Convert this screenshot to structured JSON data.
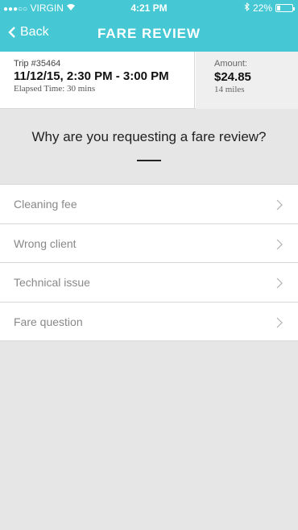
{
  "status_bar": {
    "signal_dots": "●●●○○",
    "carrier": "VIRGIN",
    "wifi_icon": "wifi-icon",
    "time": "4:21 PM",
    "bluetooth_icon": "bluetooth-icon",
    "battery_text": "22%",
    "battery_level": 0.22
  },
  "nav": {
    "back_label": "Back",
    "title": "FARE REVIEW"
  },
  "trip": {
    "id": "Trip #35464",
    "date_time": "11/12/15, 2:30 PM - 3:00 PM",
    "elapsed": "Elapsed Time: 30 mins",
    "amount_label": "Amount:",
    "amount": "$24.85",
    "distance": "14 miles"
  },
  "question": "Why are you requesting a fare review?",
  "options": [
    {
      "label": "Cleaning fee"
    },
    {
      "label": "Wrong client"
    },
    {
      "label": "Technical issue"
    },
    {
      "label": "Fare question"
    }
  ],
  "colors": {
    "header": "#45c8d4",
    "background": "#e6e6e6"
  }
}
